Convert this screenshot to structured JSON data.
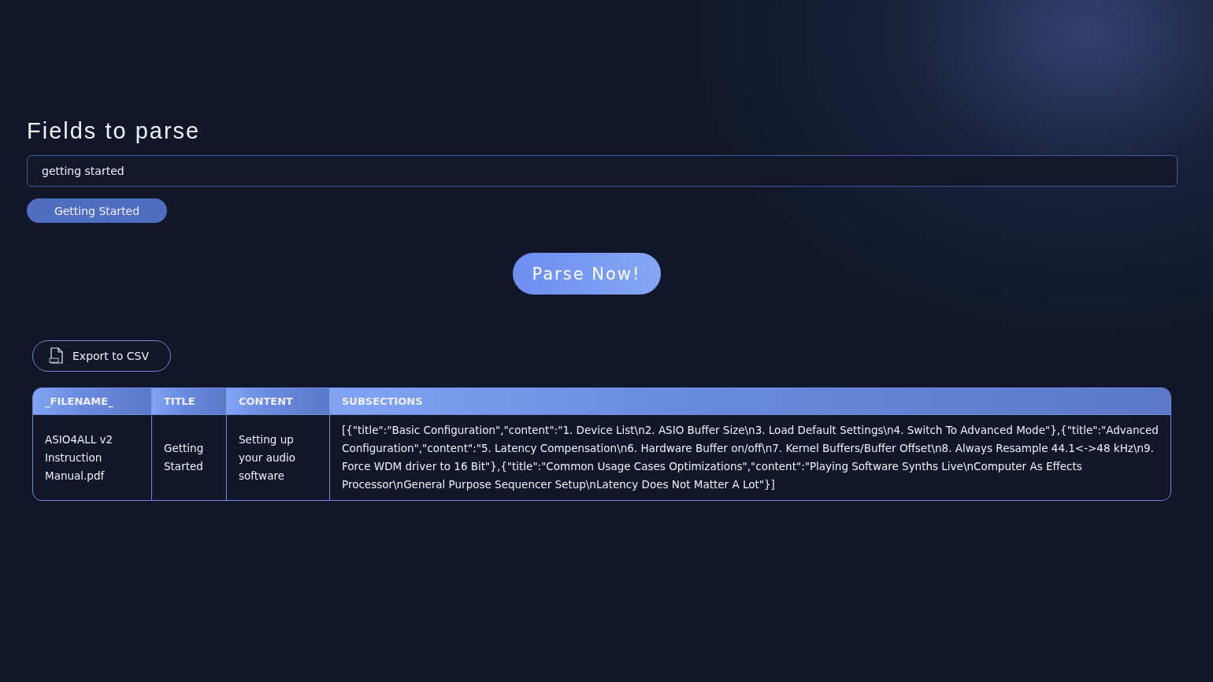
{
  "heading": "Fields to parse",
  "field": {
    "value": "getting started"
  },
  "tags": [
    {
      "label": "Getting Started"
    }
  ],
  "parse_button": "Parse Now!",
  "export_button": "Export to CSV",
  "table": {
    "columns": [
      "_FILENAME_",
      "TITLE",
      "CONTENT",
      "SUBSECTIONS"
    ],
    "rows": [
      [
        "ASIO4ALL v2 Instruction Manual.pdf",
        "Getting Started",
        "Setting up your audio software",
        "[{\"title\":\"Basic Configuration\",\"content\":\"1. Device List\\n2. ASIO Buffer Size\\n3. Load Default Settings\\n4. Switch To Advanced Mode\"},{\"title\":\"Advanced Configuration\",\"content\":\"5. Latency Compensation\\n6. Hardware Buffer on/off\\n7. Kernel Buffers/Buffer Offset\\n8. Always Resample 44.1<->48 kHz\\n9. Force WDM driver to 16 Bit\"},{\"title\":\"Common Usage Cases Optimizations\",\"content\":\"Playing Software Synths Live\\nComputer As Effects Processor\\nGeneral Purpose Sequencer Setup\\nLatency Does Not Matter A Lot\"}]"
      ]
    ]
  }
}
